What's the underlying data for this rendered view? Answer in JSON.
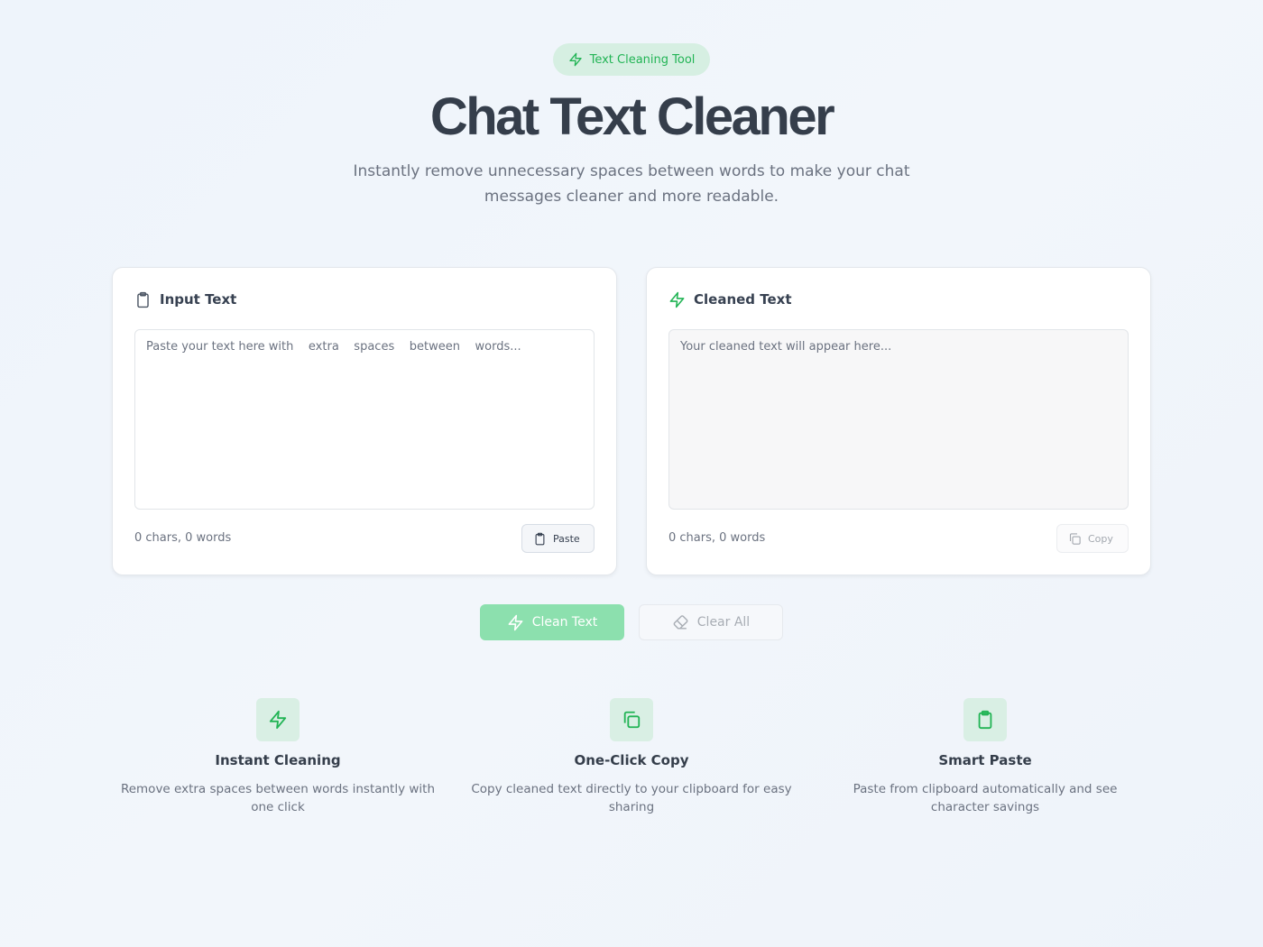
{
  "badge": {
    "label": "Text Cleaning Tool",
    "icon": "lightning-icon"
  },
  "hero": {
    "title": "Chat Text Cleaner",
    "subtitle": "Instantly remove unnecessary spaces between words to make your chat messages cleaner and more readable."
  },
  "input_card": {
    "title": "Input Text",
    "icon": "clipboard-icon",
    "value": "",
    "placeholder": "Paste your text here with    extra    spaces    between    words...",
    "counter": "0 chars, 0 words",
    "button_label": "Paste"
  },
  "output_card": {
    "title": "Cleaned Text",
    "icon": "lightning-icon",
    "value": "",
    "placeholder": "Your cleaned text will appear here...",
    "counter": "0 chars, 0 words",
    "button_label": "Copy"
  },
  "actions": {
    "clean_label": "Clean Text",
    "clear_label": "Clear All"
  },
  "features": [
    {
      "title": "Instant Cleaning",
      "description": "Remove extra spaces between words instantly with one click",
      "icon": "lightning-icon"
    },
    {
      "title": "One-Click Copy",
      "description": "Copy cleaned text directly to your clipboard for easy sharing",
      "icon": "copy-icon"
    },
    {
      "title": "Smart Paste",
      "description": "Paste from clipboard automatically and see character savings",
      "icon": "clipboard-icon"
    }
  ],
  "colors": {
    "accent": "#22c55e",
    "accent_light": "#8ce0ae",
    "badge_bg": "#d6efe2"
  }
}
